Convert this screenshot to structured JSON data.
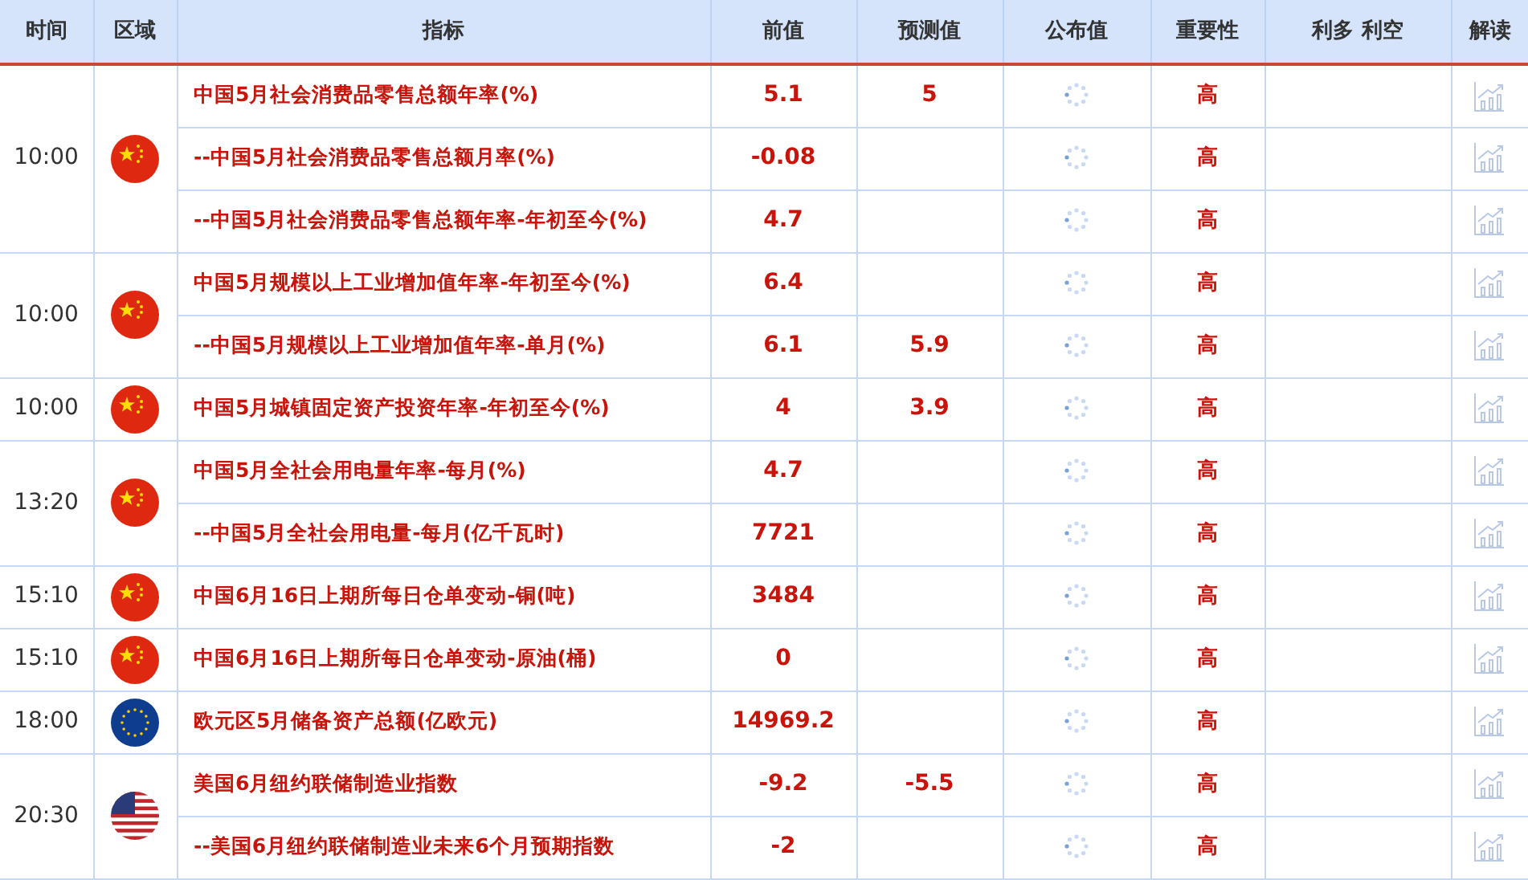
{
  "columns": [
    "时间",
    "区域",
    "指标",
    "前值",
    "预测值",
    "公布值",
    "重要性",
    "利多 利空",
    "解读"
  ],
  "groups": [
    {
      "time": "10:00",
      "kind": "cn",
      "rows": [
        {
          "indicator": "中国5月社会消费品零售总额年率(%)",
          "previous": "5.1",
          "forecast": "5",
          "importance": "高"
        },
        {
          "indicator": "--中国5月社会消费品零售总额月率(%)",
          "previous": "-0.08",
          "importance": "高"
        },
        {
          "indicator": "--中国5月社会消费品零售总额年率-年初至今(%)",
          "previous": "4.7",
          "importance": "高"
        }
      ]
    },
    {
      "time": "10:00",
      "kind": "cn",
      "rows": [
        {
          "indicator": "中国5月规模以上工业增加值年率-年初至今(%)",
          "previous": "6.4",
          "importance": "高"
        },
        {
          "indicator": "--中国5月规模以上工业增加值年率-单月(%)",
          "previous": "6.1",
          "forecast": "5.9",
          "importance": "高"
        }
      ]
    },
    {
      "time": "10:00",
      "kind": "cn",
      "rows": [
        {
          "indicator": "中国5月城镇固定资产投资年率-年初至今(%)",
          "previous": "4",
          "forecast": "3.9",
          "importance": "高"
        }
      ]
    },
    {
      "time": "13:20",
      "kind": "cn",
      "rows": [
        {
          "indicator": "中国5月全社会用电量年率-每月(%)",
          "previous": "4.7",
          "importance": "高"
        },
        {
          "indicator": "--中国5月全社会用电量-每月(亿千瓦时)",
          "previous": "7721",
          "importance": "高"
        }
      ]
    },
    {
      "time": "15:10",
      "kind": "cn",
      "rows": [
        {
          "indicator": "中国6月16日上期所每日仓单变动-铜(吨)",
          "previous": "3484",
          "importance": "高"
        }
      ]
    },
    {
      "time": "15:10",
      "kind": "cn",
      "rows": [
        {
          "indicator": "中国6月16日上期所每日仓单变动-原油(桶)",
          "previous": "0",
          "importance": "高"
        }
      ]
    },
    {
      "time": "18:00",
      "kind": "eu",
      "rows": [
        {
          "indicator": "欧元区5月储备资产总额(亿欧元)",
          "previous": "14969.2",
          "importance": "高"
        }
      ]
    },
    {
      "time": "20:30",
      "kind": "us",
      "rows": [
        {
          "indicator": "美国6月纽约联储制造业指数",
          "previous": "-9.2",
          "forecast": "-5.5",
          "importance": "高"
        },
        {
          "indicator": "--美国6月纽约联储制造业未来6个月预期指数",
          "previous": "-2",
          "importance": "高"
        }
      ]
    }
  ]
}
